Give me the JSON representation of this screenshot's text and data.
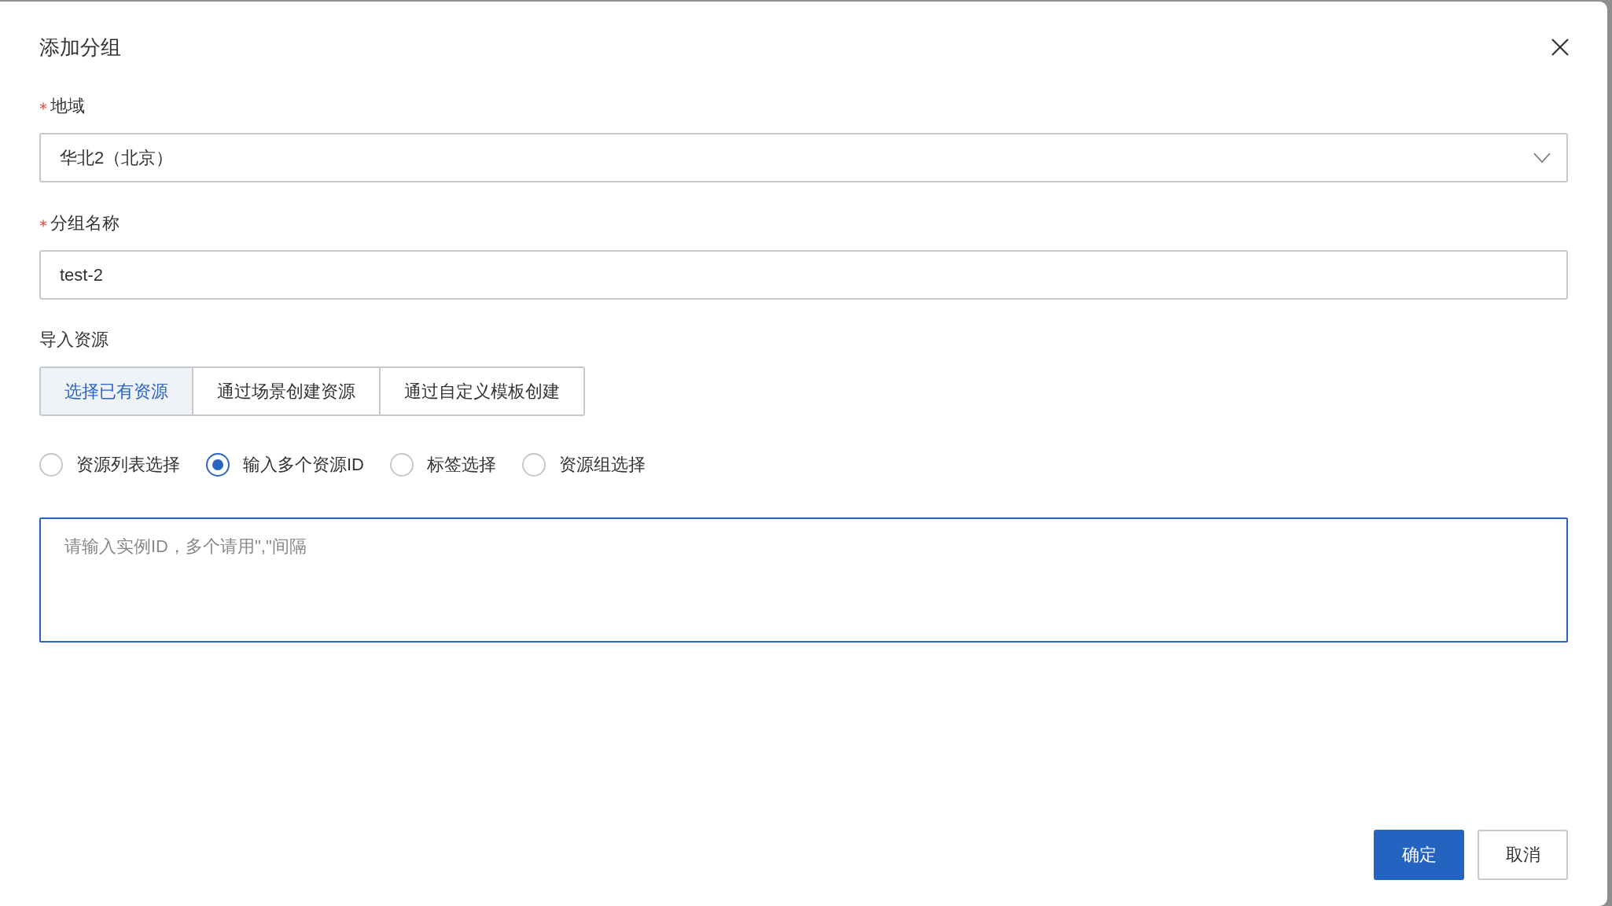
{
  "dialog": {
    "title": "添加分组"
  },
  "fields": [
    {
      "kind": "select",
      "label": "地域",
      "required": true,
      "value": "华北2（北京）"
    },
    {
      "kind": "text",
      "label": "分组名称",
      "required": true,
      "value": "test-2"
    }
  ],
  "import": {
    "label": "导入资源",
    "tabs": [
      {
        "label": "选择已有资源",
        "selected": true
      },
      {
        "label": "通过场景创建资源",
        "selected": false
      },
      {
        "label": "通过自定义模板创建",
        "selected": false
      }
    ],
    "radios": [
      {
        "label": "资源列表选择",
        "selected": false
      },
      {
        "label": "输入多个资源ID",
        "selected": true
      },
      {
        "label": "标签选择",
        "selected": false
      },
      {
        "label": "资源组选择",
        "selected": false
      }
    ],
    "textarea": {
      "placeholder": "请输入实例ID，多个请用\",\"间隔",
      "focused": true
    }
  },
  "buttons": [
    {
      "label": "确定",
      "kind": "primary"
    },
    {
      "label": "取消",
      "kind": "secondary"
    }
  ]
}
